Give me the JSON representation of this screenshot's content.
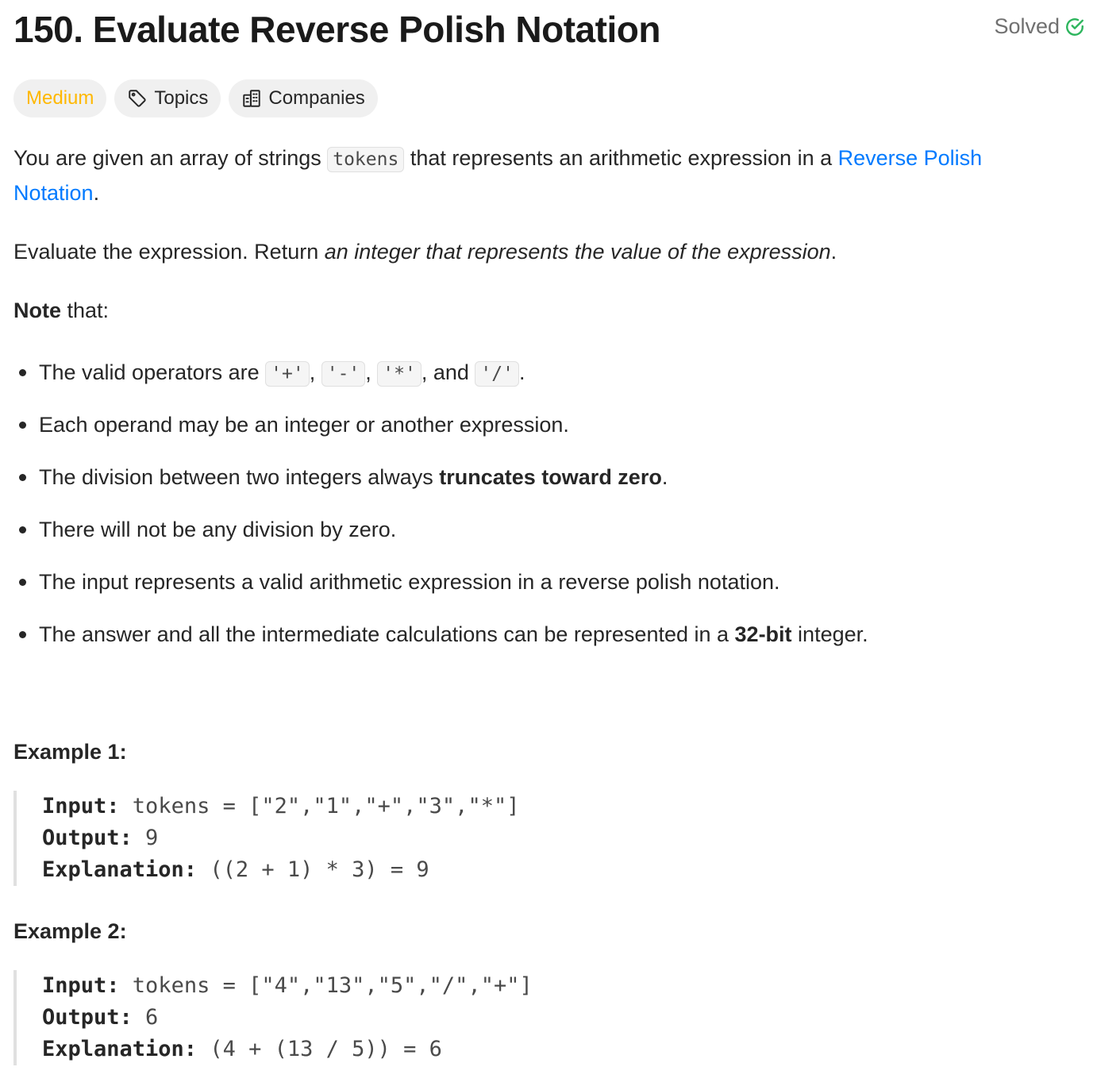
{
  "problem": {
    "title": "150. Evaluate Reverse Polish Notation",
    "status": "Solved"
  },
  "tags": {
    "difficulty": "Medium",
    "topics": "Topics",
    "companies": "Companies"
  },
  "description": {
    "p1_a": "You are given an array of strings ",
    "p1_code": "tokens",
    "p1_b": " that represents an arithmetic expression in a ",
    "p1_link": "Reverse Polish Notation",
    "p1_c": ".",
    "p2_a": "Evaluate the expression. Return ",
    "p2_em": "an integer that represents the value of the expression",
    "p2_b": ".",
    "note_bold": "Note",
    "note_rest": " that:"
  },
  "bullets": {
    "b1_a": "The valid operators are ",
    "op_plus": "'+'",
    "sep1": ", ",
    "op_minus": "'-'",
    "sep2": ", ",
    "op_times": "'*'",
    "sep3": ", and ",
    "op_div": "'/'",
    "b1_end": ".",
    "b2": "Each operand may be an integer or another expression.",
    "b3_a": "The division between two integers always ",
    "b3_bold": "truncates toward zero",
    "b3_end": ".",
    "b4": "There will not be any division by zero.",
    "b5": "The input represents a valid arithmetic expression in a reverse polish notation.",
    "b6_a": "The answer and all the intermediate calculations can be represented in a ",
    "b6_bold": "32-bit",
    "b6_end": " integer."
  },
  "examples": [
    {
      "title": "Example 1:",
      "input_label": "Input:",
      "input_value": " tokens = [\"2\",\"1\",\"+\",\"3\",\"*\"]",
      "output_label": "Output:",
      "output_value": " 9",
      "explanation_label": "Explanation:",
      "explanation_value": " ((2 + 1) * 3) = 9"
    },
    {
      "title": "Example 2:",
      "input_label": "Input:",
      "input_value": " tokens = [\"4\",\"13\",\"5\",\"/\",\"+\"]",
      "output_label": "Output:",
      "output_value": " 6",
      "explanation_label": "Explanation:",
      "explanation_value": " (4 + (13 / 5)) = 6"
    }
  ],
  "icons": {
    "solved": "check-circle-icon",
    "topics": "tag-icon",
    "companies": "building-icon"
  },
  "colors": {
    "medium": "#ffb800",
    "link": "#007aff",
    "solved_check": "#2db55d"
  }
}
